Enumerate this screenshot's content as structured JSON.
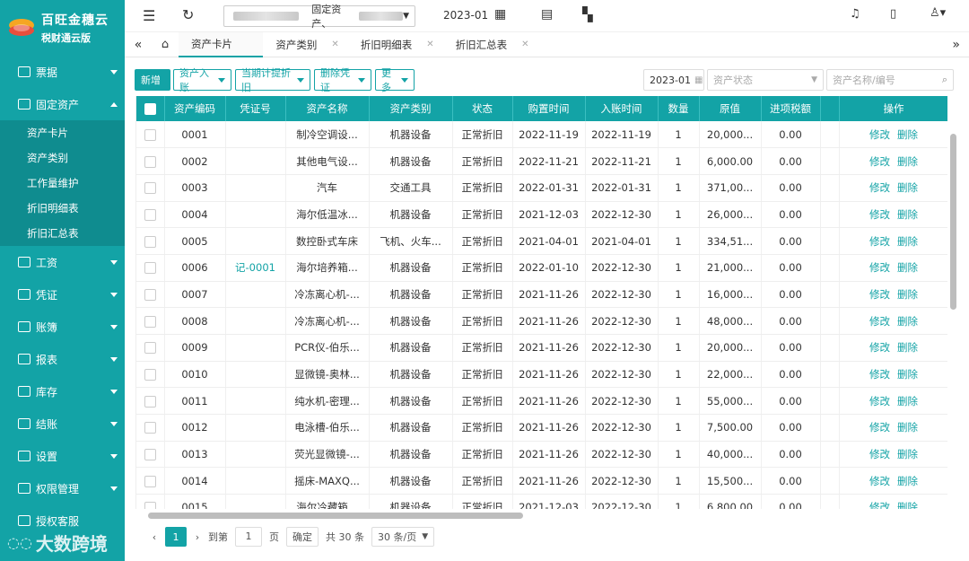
{
  "app": {
    "name": "百旺金穗云",
    "edition": "税财通云版",
    "accent": "#13a3a6"
  },
  "sidebar": {
    "items": [
      {
        "label": "票据",
        "icon": "receipt-icon"
      },
      {
        "label": "固定资产",
        "icon": "asset-icon",
        "open": true
      },
      {
        "label": "工资",
        "icon": "salary-icon"
      },
      {
        "label": "凭证",
        "icon": "voucher-icon"
      },
      {
        "label": "账簿",
        "icon": "ledger-icon"
      },
      {
        "label": "报表",
        "icon": "chart-icon"
      },
      {
        "label": "库存",
        "icon": "inventory-icon"
      },
      {
        "label": "结账",
        "icon": "closing-icon"
      },
      {
        "label": "设置",
        "icon": "settings-icon"
      },
      {
        "label": "权限管理",
        "icon": "permission-icon"
      },
      {
        "label": "授权客服",
        "icon": "service-icon"
      }
    ],
    "subitems": [
      "资产卡片",
      "资产类别",
      "工作量维护",
      "折旧明细表",
      "折旧汇总表"
    ],
    "watermark": "大数跨境"
  },
  "topbar": {
    "company_suffix": "固定资产、",
    "period": "2023-01"
  },
  "tabs": [
    "资产卡片",
    "资产类别",
    "折旧明细表",
    "折旧汇总表"
  ],
  "toolbar": {
    "add": "新增",
    "asset_entry": "资产入账",
    "depreciation": "当期计提折旧",
    "delete_voucher": "删除凭证",
    "more": "更多",
    "date": "2023-01",
    "status_placeholder": "资产状态",
    "search_placeholder": "资产名称/编号"
  },
  "table": {
    "headers": [
      "资产编码",
      "凭证号",
      "资产名称",
      "资产类别",
      "状态",
      "购置时间",
      "入账时间",
      "数量",
      "原值",
      "进项税额",
      "",
      "操作"
    ],
    "edit": "修改",
    "delete": "删除",
    "rows": [
      [
        "0001",
        "",
        "制冷空调设...",
        "机器设备",
        "正常折旧",
        "2022-11-19",
        "2022-11-19",
        "1",
        "20,000...",
        "0.00"
      ],
      [
        "0002",
        "",
        "其他电气设...",
        "机器设备",
        "正常折旧",
        "2022-11-21",
        "2022-11-21",
        "1",
        "6,000.00",
        "0.00"
      ],
      [
        "0003",
        "",
        "汽车",
        "交通工具",
        "正常折旧",
        "2022-01-31",
        "2022-01-31",
        "1",
        "371,00...",
        "0.00"
      ],
      [
        "0004",
        "",
        "海尔低温冰...",
        "机器设备",
        "正常折旧",
        "2021-12-03",
        "2022-12-30",
        "1",
        "26,000...",
        "0.00"
      ],
      [
        "0005",
        "",
        "数控卧式车床",
        "飞机、火车...",
        "正常折旧",
        "2021-04-01",
        "2021-04-01",
        "1",
        "334,51...",
        "0.00"
      ],
      [
        "0006",
        "记-0001",
        "海尔培养箱...",
        "机器设备",
        "正常折旧",
        "2022-01-10",
        "2022-12-30",
        "1",
        "21,000...",
        "0.00"
      ],
      [
        "0007",
        "",
        "冷冻离心机-...",
        "机器设备",
        "正常折旧",
        "2021-11-26",
        "2022-12-30",
        "1",
        "16,000...",
        "0.00"
      ],
      [
        "0008",
        "",
        "冷冻离心机-...",
        "机器设备",
        "正常折旧",
        "2021-11-26",
        "2022-12-30",
        "1",
        "48,000...",
        "0.00"
      ],
      [
        "0009",
        "",
        "PCR仪-伯乐...",
        "机器设备",
        "正常折旧",
        "2021-11-26",
        "2022-12-30",
        "1",
        "20,000...",
        "0.00"
      ],
      [
        "0010",
        "",
        "显微镜-奥林...",
        "机器设备",
        "正常折旧",
        "2021-11-26",
        "2022-12-30",
        "1",
        "22,000...",
        "0.00"
      ],
      [
        "0011",
        "",
        "纯水机-密理...",
        "机器设备",
        "正常折旧",
        "2021-11-26",
        "2022-12-30",
        "1",
        "55,000...",
        "0.00"
      ],
      [
        "0012",
        "",
        "电泳槽-伯乐...",
        "机器设备",
        "正常折旧",
        "2021-11-26",
        "2022-12-30",
        "1",
        "7,500.00",
        "0.00"
      ],
      [
        "0013",
        "",
        "荧光显微镜-...",
        "机器设备",
        "正常折旧",
        "2021-11-26",
        "2022-12-30",
        "1",
        "40,000...",
        "0.00"
      ],
      [
        "0014",
        "",
        "摇床-MAXQ...",
        "机器设备",
        "正常折旧",
        "2021-11-26",
        "2022-12-30",
        "1",
        "15,500...",
        "0.00"
      ],
      [
        "0015",
        "",
        "海尔冷藏箱...",
        "机器设备",
        "正常折旧",
        "2021-12-03",
        "2022-12-30",
        "1",
        "6,800.00",
        "0.00"
      ]
    ]
  },
  "pager": {
    "current": "1",
    "goto": "到第",
    "page_value": "1",
    "page_unit": "页",
    "confirm": "确定",
    "total": "共 30 条",
    "size": "30 条/页"
  }
}
